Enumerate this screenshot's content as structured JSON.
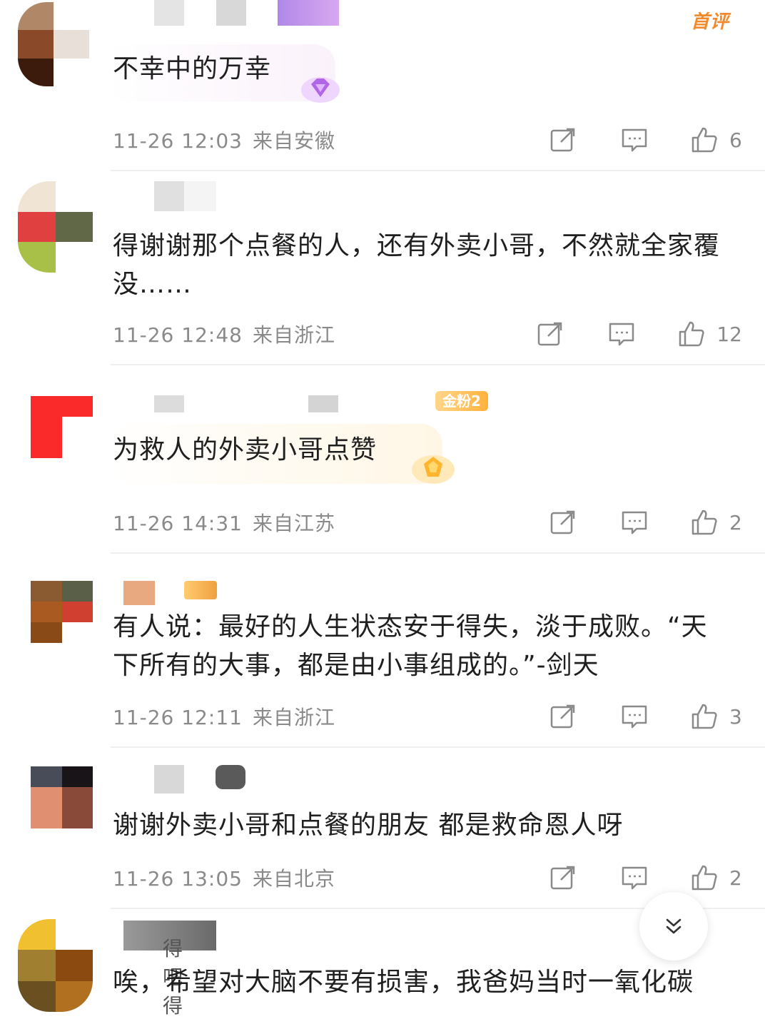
{
  "comments": [
    {
      "text": "不幸中的万幸",
      "time": "11-26 12:03",
      "location": "来自安徽",
      "likes": "6",
      "badge": "首评"
    },
    {
      "text": "得谢谢那个点餐的人，还有外卖小哥，不然就全家覆没……",
      "time": "11-26 12:48",
      "location": "来自浙江",
      "likes": "12"
    },
    {
      "text": "为救人的外卖小哥点赞",
      "time": "11-26 14:31",
      "location": "来自江苏",
      "likes": "2",
      "fan_badge": "金粉2"
    },
    {
      "text": "有人说：最好的人生状态安于得失，淡于成败。“天下所有的大事，都是由小事组成的。”-剑天",
      "time": "11-26 12:11",
      "location": "来自浙江",
      "likes": "3"
    },
    {
      "text": "谢谢外卖小哥和点餐的朋友 都是救命恩人呀",
      "time": "11-26 13:05",
      "location": "来自北京",
      "likes": "2"
    },
    {
      "text": "唉，希望对大脑不要有损害，我爸妈当时一氧化碳",
      "name_suffix": "得吧得"
    }
  ],
  "icons": {
    "share": "share-icon",
    "reply": "comment-icon",
    "like": "thumbs-up-icon",
    "scroll": "chevron-double-down-icon"
  },
  "colors": {
    "accent": "#f08a2c",
    "meta_text": "#8a8a8a"
  }
}
